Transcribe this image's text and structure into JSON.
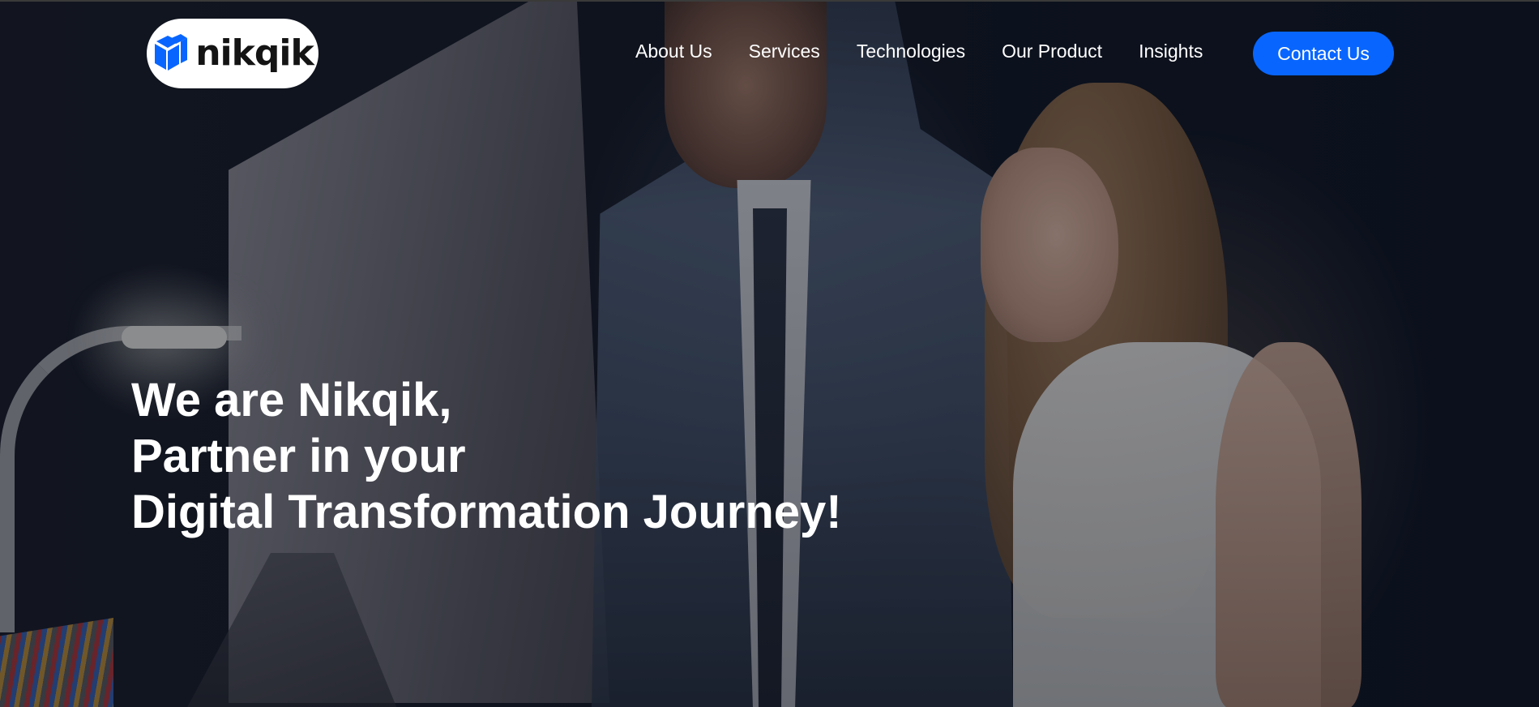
{
  "brand": {
    "name": "nikqik",
    "logo_icon": "cube-icon",
    "accent_color": "#0866ff"
  },
  "nav": {
    "items": [
      {
        "label": "About Us"
      },
      {
        "label": "Services"
      },
      {
        "label": "Technologies"
      },
      {
        "label": "Our Product"
      },
      {
        "label": "Insights"
      }
    ],
    "cta_label": "Contact Us"
  },
  "hero": {
    "lines": [
      "We are Nikqik,",
      "Partner in your",
      "Digital Transformation Journey!"
    ]
  }
}
